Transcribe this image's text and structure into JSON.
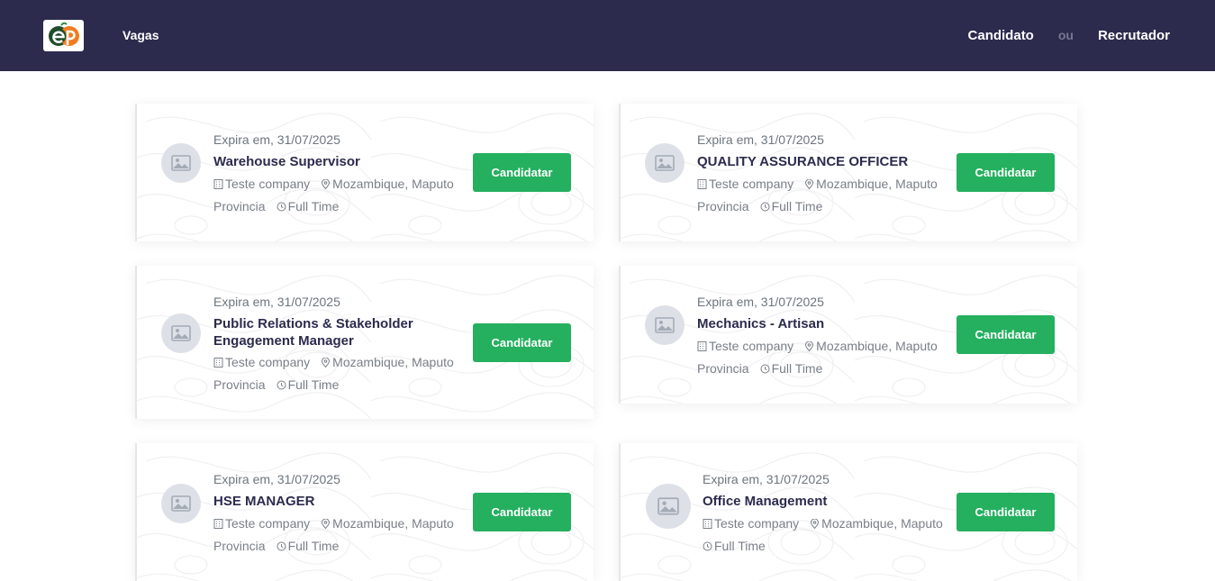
{
  "navbar": {
    "brand_color": "#2c2b4e",
    "vagas": "Vagas",
    "candidato": "Candidato",
    "ou": "ou",
    "recrutador": "Recrutador"
  },
  "colors": {
    "accent": "#25b05f",
    "title": "#2c2b4e"
  },
  "jobs": [
    {
      "expira": "Expira em, 31/07/2025",
      "title": "Warehouse Supervisor",
      "company": "Teste company",
      "location": "Mozambique, Maputo",
      "province": "Provincia",
      "type": "Full Time",
      "button": "Candidatar"
    },
    {
      "expira": "Expira em, 31/07/2025",
      "title": "QUALITY ASSURANCE OFFICER",
      "company": "Teste company",
      "location": "Mozambique, Maputo",
      "province": "Provincia",
      "type": "Full Time",
      "button": "Candidatar"
    },
    {
      "expira": "Expira em, 31/07/2025",
      "title": "Public Relations & Stakeholder Engagement Manager",
      "company": "Teste company",
      "location": "Mozambique, Maputo",
      "province": "Provincia",
      "type": "Full Time",
      "button": "Candidatar"
    },
    {
      "expira": "Expira em, 31/07/2025",
      "title": "Mechanics - Artisan",
      "company": "Teste company",
      "location": "Mozambique, Maputo",
      "province": "Provincia",
      "type": "Full Time",
      "button": "Candidatar"
    },
    {
      "expira": "Expira em, 31/07/2025",
      "title": "HSE MANAGER",
      "company": "Teste company",
      "location": "Mozambique, Maputo",
      "province": "Provincia",
      "type": "Full Time",
      "button": "Candidatar"
    },
    {
      "expira": "Expira em, 31/07/2025",
      "title": "Office Management",
      "company": "Teste company",
      "location": "Mozambique, Maputo",
      "province": "",
      "type": "Full Time",
      "button": "Candidatar"
    }
  ]
}
